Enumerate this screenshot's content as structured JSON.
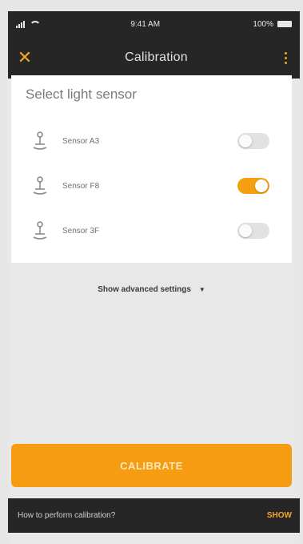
{
  "status_bar": {
    "time": "9:41 AM",
    "battery": "100%"
  },
  "app_bar": {
    "title": "Calibration",
    "close_icon": "close-icon",
    "menu_icon": "more-vertical-icon"
  },
  "sensor_panel": {
    "title": "Select light sensor",
    "sensors": [
      {
        "label": "Sensor A3",
        "enabled": false,
        "icon": "light-sensor-icon"
      },
      {
        "label": "Sensor F8",
        "enabled": true,
        "icon": "light-sensor-icon"
      },
      {
        "label": "Sensor 3F",
        "enabled": false,
        "icon": "light-sensor-icon"
      }
    ]
  },
  "advanced": {
    "label": "Show advanced settings",
    "icon": "caret-down-icon"
  },
  "calibrate": {
    "label": "CALIBRATE"
  },
  "snackbar": {
    "message": "How to perform calibration?",
    "action": "SHOW"
  },
  "colors": {
    "accent": "#f59c10",
    "bar": "#262626",
    "background": "#e8e8e8"
  }
}
